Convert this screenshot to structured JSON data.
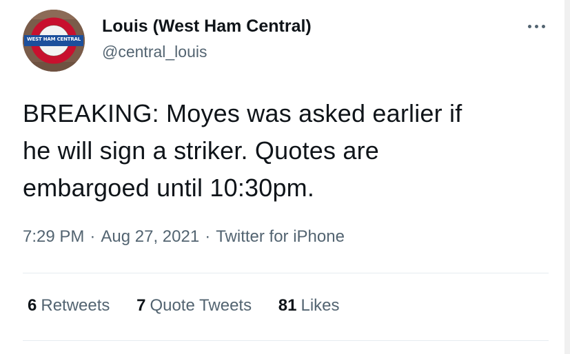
{
  "author": {
    "display_name": "Louis (West Ham Central)",
    "handle": "@central_louis",
    "avatar_text": "WEST HAM CENTRAL"
  },
  "tweet": {
    "text": "BREAKING: Moyes was asked earlier if\nhe will sign a striker. Quotes are\nembargoed until 10:30pm.",
    "time": "7:29 PM",
    "date": "Aug 27, 2021",
    "source": "Twitter for iPhone",
    "separator": "·"
  },
  "stats": {
    "retweets_count": "6",
    "retweets_label": "Retweets",
    "quotes_count": "7",
    "quotes_label": "Quote Tweets",
    "likes_count": "81",
    "likes_label": "Likes"
  },
  "icons": {
    "more": "more-options-icon"
  }
}
